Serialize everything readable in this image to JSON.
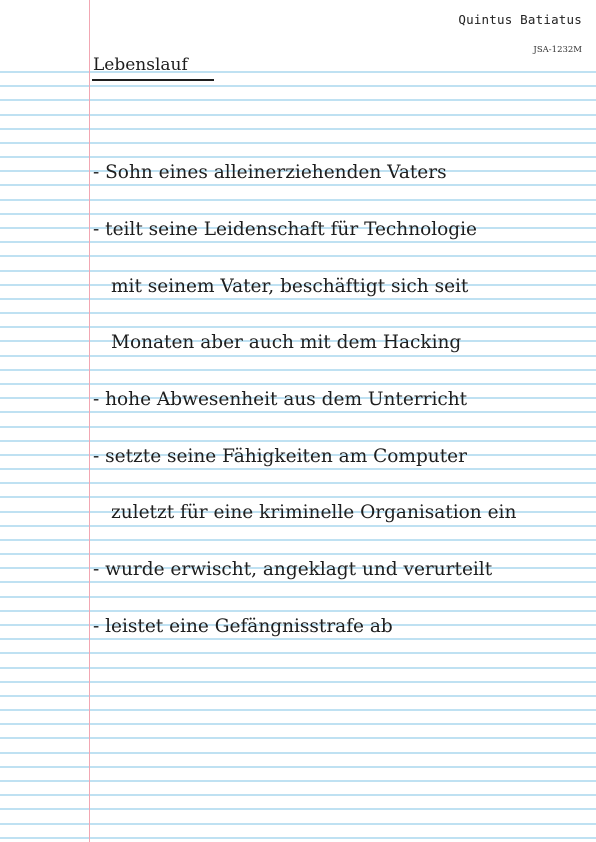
{
  "author": "Quintus Batiatus",
  "doc_id": "JSA-1232M",
  "title": "Lebenslauf",
  "lines": [
    "- Sohn eines alleinerziehenden Vaters",
    "- teilt seine Leidenschaft für Technologie",
    "mit seinem Vater, beschäftigt sich seit",
    "Monaten aber auch mit dem Hacking",
    "- hohe Abwesenheit aus dem Unterricht",
    "- setzte seine Fähigkeiten am Computer",
    "zuletzt für eine kriminelle Organisation ein",
    "- wurde erwischt, angeklagt und verurteilt",
    "- leistet eine Gefängnisstrafe ab"
  ],
  "colors": {
    "rule": "#bfe1f2",
    "margin": "#f2a7b3",
    "ink": "#1e1e1e"
  }
}
